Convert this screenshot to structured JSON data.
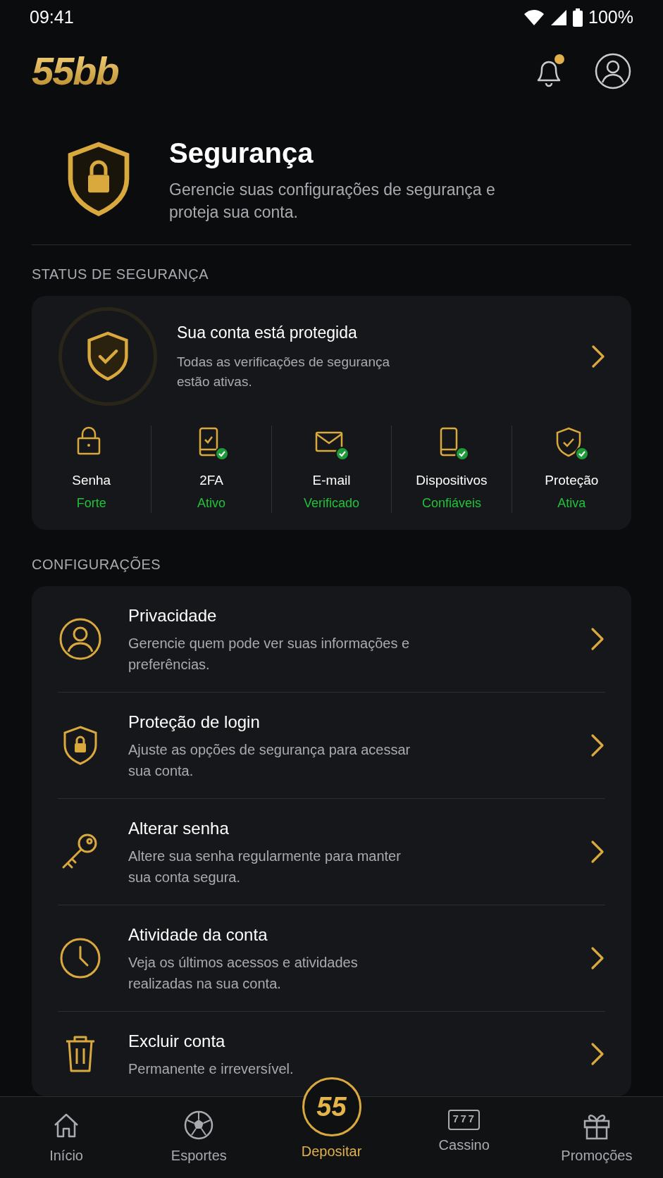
{
  "status_bar": {
    "time": "09:41",
    "battery": "100%"
  },
  "header": {
    "logo": "55bb",
    "notification_dot": true
  },
  "hero": {
    "title": "Segurança",
    "subtitle": "Gerencie suas configurações de segurança e proteja sua conta."
  },
  "security_status": {
    "label": "STATUS DE SEGURANÇA",
    "title": "Sua conta está protegida",
    "description": "Todas as verificações de segurança estão ativas.",
    "items": [
      {
        "label": "Senha",
        "value": "Forte",
        "verified": false
      },
      {
        "label": "2FA",
        "value": "Ativo",
        "verified": true
      },
      {
        "label": "E-mail",
        "value": "Verificado",
        "verified": true
      },
      {
        "label": "Dispositivos",
        "value": "Confiáveis",
        "verified": true
      },
      {
        "label": "Proteção",
        "value": "Ativa",
        "verified": true
      }
    ]
  },
  "settings": {
    "label": "CONFIGURAÇÕES",
    "items": [
      {
        "title": "Privacidade",
        "description": "Gerencie quem pode ver suas informações e preferências."
      },
      {
        "title": "Proteção de login",
        "description": "Ajuste as opções de segurança para acessar sua conta."
      },
      {
        "title": "Alterar senha",
        "description": "Altere sua senha regularmente para manter sua conta segura."
      },
      {
        "title": "Atividade da conta",
        "description": "Veja os últimos acessos e atividades realizadas na sua conta."
      },
      {
        "title": "Excluir conta",
        "description": "Permanente e irreversível."
      }
    ]
  },
  "bottom_nav": [
    {
      "label": "Início",
      "selected": false
    },
    {
      "label": "Esportes",
      "selected": false
    },
    {
      "label": "Depositar",
      "selected": true,
      "badge": "55"
    },
    {
      "label": "Cassino",
      "selected": false,
      "icon_text": "777"
    },
    {
      "label": "Promoções",
      "selected": false
    }
  ]
}
